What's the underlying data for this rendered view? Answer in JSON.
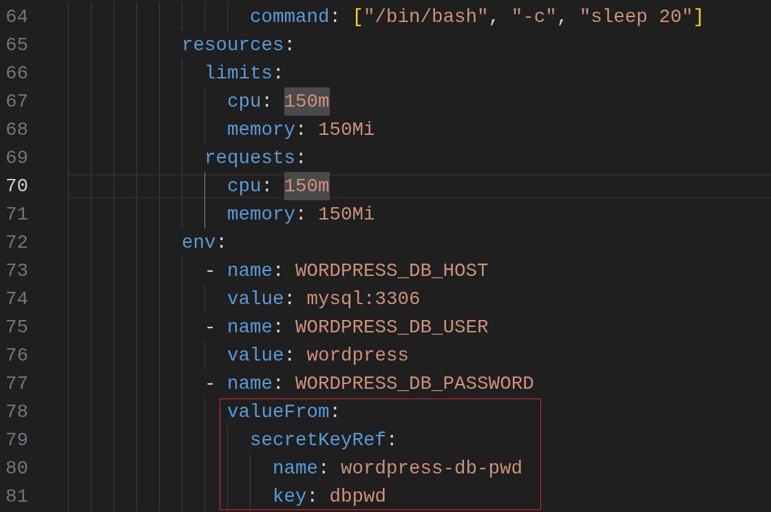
{
  "lines": [
    {
      "active_guide": false,
      "children": [
        {
          "active_guide": false,
          "children": [
            {
              "active_guide": false,
              "children": [
                {
                  "number": "64",
                  "key": "command",
                  "separator": ":",
                  "value": {
                    "kind": "flow_sequence",
                    "open": "[",
                    "items": [
                      "\"/bin/bash\"",
                      "\"-c\"",
                      "\"sleep 20\""
                    ],
                    "delimiter": ",",
                    "close": "]",
                    "highlighted": false
                  },
                  "current": false,
                  "boxed": false
                }
              ]
            }
          ]
        }
      ]
    },
    {
      "number": "65",
      "key": "resources",
      "separator": ":",
      "current": false,
      "boxed": false,
      "active_guide": false,
      "children": [
        {
          "number": "66",
          "key": "limits",
          "separator": ":",
          "current": false,
          "boxed": false,
          "active_guide": false,
          "children": [
            {
              "number": "67",
              "key": "cpu",
              "separator": ":",
              "value": {
                "kind": "scalar",
                "text": "150m",
                "highlighted": true
              },
              "current": false,
              "boxed": false
            },
            {
              "number": "68",
              "key": "memory",
              "separator": ":",
              "value": {
                "kind": "scalar",
                "text": "150Mi",
                "highlighted": false
              },
              "current": false,
              "boxed": false
            }
          ]
        },
        {
          "number": "69",
          "key": "requests",
          "separator": ":",
          "current": false,
          "boxed": false,
          "active_guide": true,
          "children": [
            {
              "number": "70",
              "key": "cpu",
              "separator": ":",
              "value": {
                "kind": "scalar",
                "text": "150m",
                "highlighted": true
              },
              "current": true,
              "boxed": false
            },
            {
              "number": "71",
              "key": "memory",
              "separator": ":",
              "value": {
                "kind": "scalar",
                "text": "150Mi",
                "highlighted": false
              },
              "current": false,
              "boxed": false
            }
          ]
        }
      ]
    },
    {
      "number": "72",
      "key": "env",
      "separator": ":",
      "current": false,
      "boxed": false,
      "active_guide": false,
      "children": [
        {
          "number": "73",
          "marker": "-",
          "key": "name",
          "separator": ":",
          "value": {
            "kind": "scalar",
            "text": "WORDPRESS_DB_HOST",
            "highlighted": false
          },
          "current": false,
          "boxed": false,
          "active_guide": false,
          "children": [
            {
              "number": "74",
              "key": "value",
              "separator": ":",
              "value": {
                "kind": "scalar",
                "text": "mysql:3306",
                "highlighted": false
              },
              "current": false,
              "boxed": false
            }
          ]
        },
        {
          "number": "75",
          "marker": "-",
          "key": "name",
          "separator": ":",
          "value": {
            "kind": "scalar",
            "text": "WORDPRESS_DB_USER",
            "highlighted": false
          },
          "current": false,
          "boxed": false,
          "active_guide": false,
          "children": [
            {
              "number": "76",
              "key": "value",
              "separator": ":",
              "value": {
                "kind": "scalar",
                "text": "wordpress",
                "highlighted": false
              },
              "current": false,
              "boxed": false
            }
          ]
        },
        {
          "number": "77",
          "marker": "-",
          "key": "name",
          "separator": ":",
          "value": {
            "kind": "scalar",
            "text": "WORDPRESS_DB_PASSWORD",
            "highlighted": false
          },
          "current": false,
          "boxed": false,
          "active_guide": false,
          "children": [
            {
              "number": "78",
              "key": "valueFrom",
              "separator": ":",
              "current": false,
              "boxed": true,
              "active_guide": false,
              "children": [
                {
                  "number": "79",
                  "key": "secretKeyRef",
                  "separator": ":",
                  "current": false,
                  "boxed": true,
                  "active_guide": false,
                  "children": [
                    {
                      "number": "80",
                      "key": "name",
                      "separator": ":",
                      "value": {
                        "kind": "scalar",
                        "text": "wordpress-db-pwd",
                        "highlighted": false
                      },
                      "current": false,
                      "boxed": true
                    },
                    {
                      "number": "81",
                      "key": "key",
                      "separator": ":",
                      "value": {
                        "kind": "scalar",
                        "text": "dbpwd",
                        "highlighted": false
                      },
                      "current": false,
                      "boxed": true
                    }
                  ]
                }
              ]
            }
          ]
        }
      ]
    }
  ]
}
